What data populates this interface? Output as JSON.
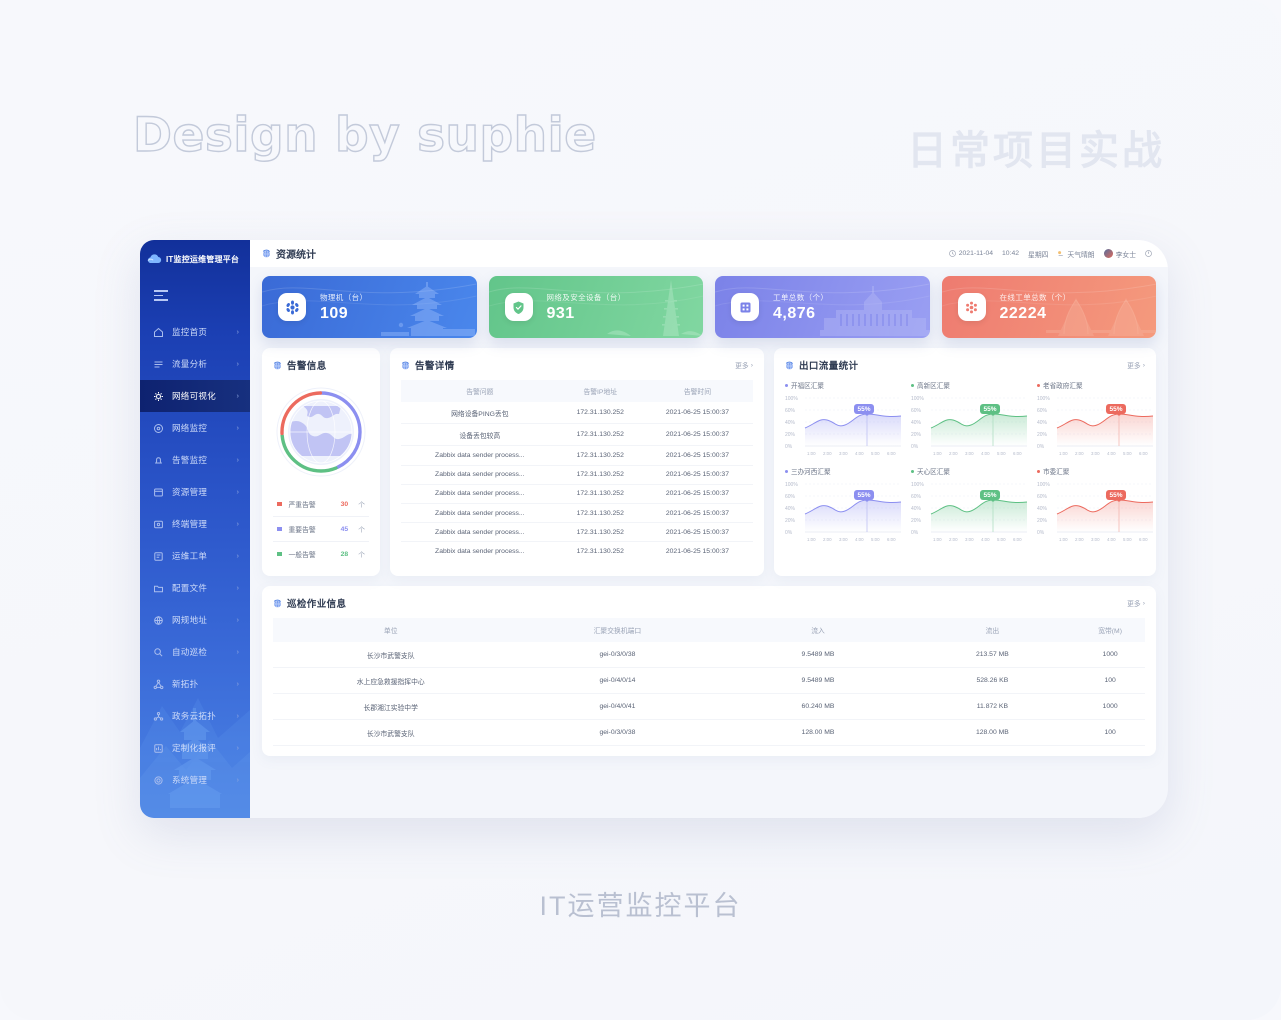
{
  "watermarks": {
    "left": "Design by suphie",
    "right": "日常项目实战",
    "caption": "IT运营监控平台"
  },
  "sidebar": {
    "logo": "IT监控运维管理平台",
    "items": [
      {
        "label": "监控首页",
        "icon": "home-icon",
        "active": false
      },
      {
        "label": "流量分析",
        "icon": "flow-icon",
        "active": false
      },
      {
        "label": "网络可视化",
        "icon": "network-visual-icon",
        "active": true
      },
      {
        "label": "网络监控",
        "icon": "network-monitor-icon",
        "active": false
      },
      {
        "label": "告警监控",
        "icon": "bell-icon",
        "active": false
      },
      {
        "label": "资源管理",
        "icon": "resource-icon",
        "active": false
      },
      {
        "label": "终端管理",
        "icon": "terminal-icon",
        "active": false
      },
      {
        "label": "运维工单",
        "icon": "ticket-icon",
        "active": false
      },
      {
        "label": "配置文件",
        "icon": "folder-icon",
        "active": false
      },
      {
        "label": "网规地址",
        "icon": "address-icon",
        "active": false
      },
      {
        "label": "自动巡检",
        "icon": "auto-inspect-icon",
        "active": false
      },
      {
        "label": "新拓扑",
        "icon": "topology-icon",
        "active": false
      },
      {
        "label": "政务云拓扑",
        "icon": "cloud-topology-icon",
        "active": false
      },
      {
        "label": "定制化报评",
        "icon": "report-icon",
        "active": false
      },
      {
        "label": "系统管理",
        "icon": "gear-icon",
        "active": false
      }
    ]
  },
  "topbar": {
    "title": "资源统计",
    "date": "2021-11-04",
    "time": "10:42",
    "weekday": "星期四",
    "weather": "天气晴朗",
    "user": "李女士"
  },
  "cards": [
    {
      "label": "物理机（台）",
      "value": "109",
      "color": "#3d6fd8",
      "color2": "#4a86ea",
      "icon": "server-icon",
      "art": "pagoda"
    },
    {
      "label": "网络及安全设备（台）",
      "value": "931",
      "color": "#5ec084",
      "color2": "#79d39b",
      "icon": "shield-icon",
      "art": "tower"
    },
    {
      "label": "工单总数（个）",
      "value": "4,876",
      "color": "#7b82e8",
      "color2": "#9096ef",
      "icon": "ticket-icon",
      "art": "building"
    },
    {
      "label": "在线工单总数（个）",
      "value": "22224",
      "color": "#ec7a74",
      "color2": "#f39378",
      "icon": "alert-icon",
      "art": "bridge"
    }
  ],
  "alert_panel": {
    "title": "告警信息",
    "legend": [
      {
        "name": "严重告警",
        "value": "30",
        "unit": "个",
        "color": "#ec6a5e"
      },
      {
        "name": "重要告警",
        "value": "45",
        "unit": "个",
        "color": "#8c8ff0"
      },
      {
        "name": "一般告警",
        "value": "28",
        "unit": "个",
        "color": "#5ec084"
      }
    ],
    "donut": [
      {
        "name": "重要告警",
        "pct": 43,
        "color": "#8c8ff0"
      },
      {
        "name": "一般告警",
        "pct": 30,
        "color": "#5ec084"
      },
      {
        "name": "严重告警",
        "pct": 27,
        "color": "#ec6a5e"
      }
    ]
  },
  "detail_panel": {
    "title": "告警详情",
    "more": "更多",
    "columns": [
      "告警问题",
      "告警IP地址",
      "告警时间"
    ],
    "rows": [
      [
        "网络设备PING丢包",
        "172.31.130.252",
        "2021-06-25  15:00:37"
      ],
      [
        "设备丢包较高",
        "172.31.130.252",
        "2021-06-25  15:00:37"
      ],
      [
        "Zabbix data sender process...",
        "172.31.130.252",
        "2021-06-25  15:00:37"
      ],
      [
        "Zabbix data sender process...",
        "172.31.130.252",
        "2021-06-25  15:00:37"
      ],
      [
        "Zabbix data sender process...",
        "172.31.130.252",
        "2021-06-25  15:00:37"
      ],
      [
        "Zabbix data sender process...",
        "172.31.130.252",
        "2021-06-25  15:00:37"
      ],
      [
        "Zabbix data sender process...",
        "172.31.130.252",
        "2021-06-25  15:00:37"
      ],
      [
        "Zabbix data sender process...",
        "172.31.130.252",
        "2021-06-25  15:00:37"
      ]
    ]
  },
  "traffic_panel": {
    "title": "出口流量统计",
    "more": "更多"
  },
  "chart_data": [
    {
      "type": "area",
      "title": "开福区汇聚",
      "color": "#8c8ff0",
      "x": [
        "1:00",
        "2:00",
        "3:00",
        "4:00",
        "5:00",
        "6:00"
      ],
      "values": [
        38,
        46,
        40,
        52,
        55,
        48
      ],
      "ylabel": "",
      "xlabel": "",
      "yticks": [
        "100%",
        "60%",
        "40%",
        "20%",
        "0%"
      ],
      "ylim": [
        0,
        100
      ],
      "annotation": "55%",
      "grid": true
    },
    {
      "type": "area",
      "title": "高新区汇聚",
      "color": "#5ec084",
      "x": [
        "1:00",
        "2:00",
        "3:00",
        "4:00",
        "5:00",
        "6:00"
      ],
      "values": [
        38,
        46,
        40,
        52,
        55,
        48
      ],
      "ylabel": "",
      "xlabel": "",
      "yticks": [
        "100%",
        "60%",
        "40%",
        "20%",
        "0%"
      ],
      "ylim": [
        0,
        100
      ],
      "annotation": "55%",
      "grid": true
    },
    {
      "type": "area",
      "title": "老省政府汇聚",
      "color": "#ec6a5e",
      "x": [
        "1:00",
        "2:00",
        "3:00",
        "4:00",
        "5:00",
        "6:00"
      ],
      "values": [
        38,
        46,
        40,
        52,
        55,
        48
      ],
      "ylabel": "",
      "xlabel": "",
      "yticks": [
        "100%",
        "60%",
        "40%",
        "20%",
        "0%"
      ],
      "ylim": [
        0,
        100
      ],
      "annotation": "55%",
      "grid": true
    },
    {
      "type": "area",
      "title": "三办河西汇聚",
      "color": "#8c8ff0",
      "x": [
        "1:00",
        "2:00",
        "3:00",
        "4:00",
        "5:00",
        "6:00"
      ],
      "values": [
        38,
        46,
        40,
        52,
        55,
        48
      ],
      "ylabel": "",
      "xlabel": "",
      "yticks": [
        "100%",
        "60%",
        "40%",
        "20%",
        "0%"
      ],
      "ylim": [
        0,
        100
      ],
      "annotation": "55%",
      "grid": true
    },
    {
      "type": "area",
      "title": "天心区汇聚",
      "color": "#5ec084",
      "x": [
        "1:00",
        "2:00",
        "3:00",
        "4:00",
        "5:00",
        "6:00"
      ],
      "values": [
        38,
        46,
        40,
        52,
        55,
        48
      ],
      "ylabel": "",
      "xlabel": "",
      "yticks": [
        "100%",
        "60%",
        "40%",
        "20%",
        "0%"
      ],
      "ylim": [
        0,
        100
      ],
      "annotation": "55%",
      "grid": true
    },
    {
      "type": "area",
      "title": "市委汇聚",
      "color": "#ec6a5e",
      "x": [
        "1:00",
        "2:00",
        "3:00",
        "4:00",
        "5:00",
        "6:00"
      ],
      "values": [
        38,
        46,
        40,
        52,
        55,
        48
      ],
      "ylabel": "",
      "xlabel": "",
      "yticks": [
        "100%",
        "60%",
        "40%",
        "20%",
        "0%"
      ],
      "ylim": [
        0,
        100
      ],
      "annotation": "55%",
      "grid": true
    }
  ],
  "inspect_panel": {
    "title": "巡检作业信息",
    "more": "更多",
    "columns": [
      "单位",
      "汇聚交换机端口",
      "流入",
      "流出",
      "宽带(M)"
    ],
    "rows": [
      [
        "长沙市武警支队",
        "gei-0/3/0/38",
        "9.5489 MB",
        "213.57 MB",
        "1000"
      ],
      [
        "水上应急救援指挥中心",
        "gei-0/4/0/14",
        "9.5489 MB",
        "528.26 KB",
        "100"
      ],
      [
        "长郡湘江实验中学",
        "gei-0/4/0/41",
        "60.240 MB",
        "11.872 KB",
        "1000"
      ],
      [
        "长沙市武警支队",
        "gei-0/3/0/38",
        "128.00 MB",
        "128.00 MB",
        "100"
      ]
    ]
  }
}
